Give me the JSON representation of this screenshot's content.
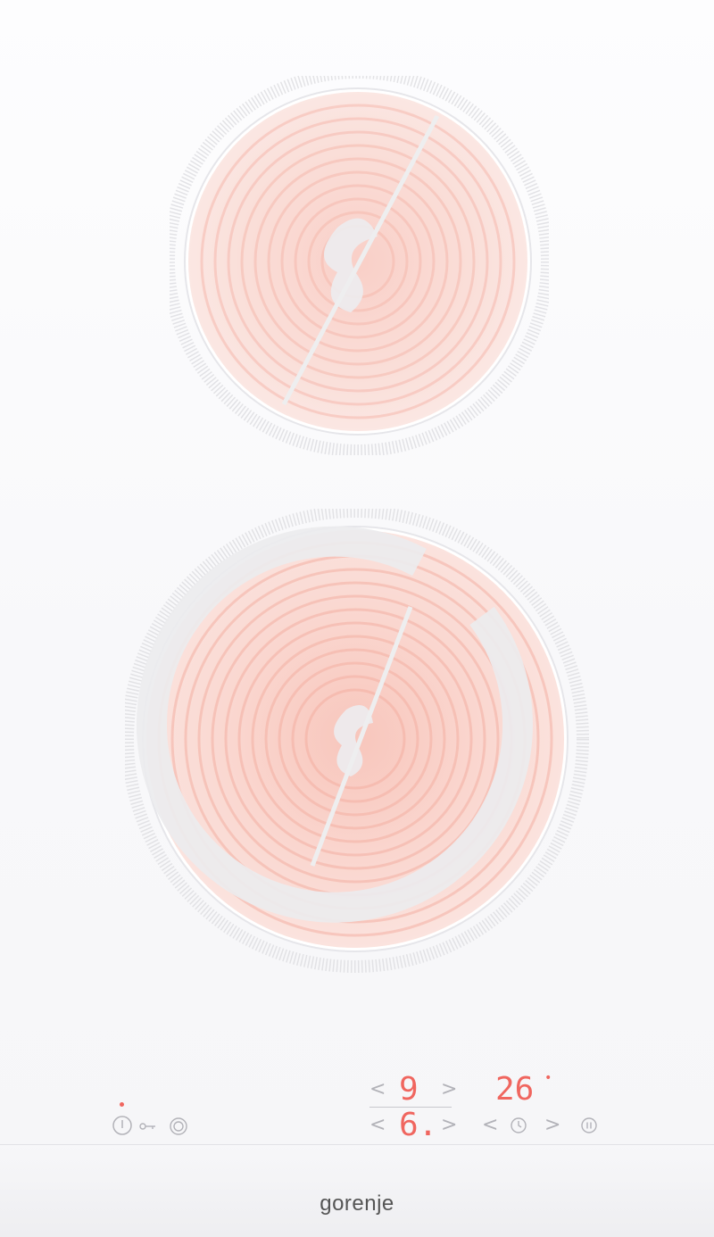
{
  "brand": {
    "logo_text": "gorenje"
  },
  "colors": {
    "accent": "#f0665f",
    "glass": "#fbfbfc",
    "control": "#b2b2b8"
  },
  "zones": {
    "rear": {
      "name": "single zone"
    },
    "front": {
      "name": "dual zone"
    }
  },
  "display": {
    "top_level": "9",
    "bottom_level": "6.",
    "timer": "26",
    "timer_dot": "•"
  },
  "controls": {
    "left_arrow": "<",
    "right_arrow": ">",
    "icons": [
      "power-icon",
      "lock-icon",
      "dual-zone-icon",
      "timer-icon",
      "pause-icon"
    ]
  }
}
